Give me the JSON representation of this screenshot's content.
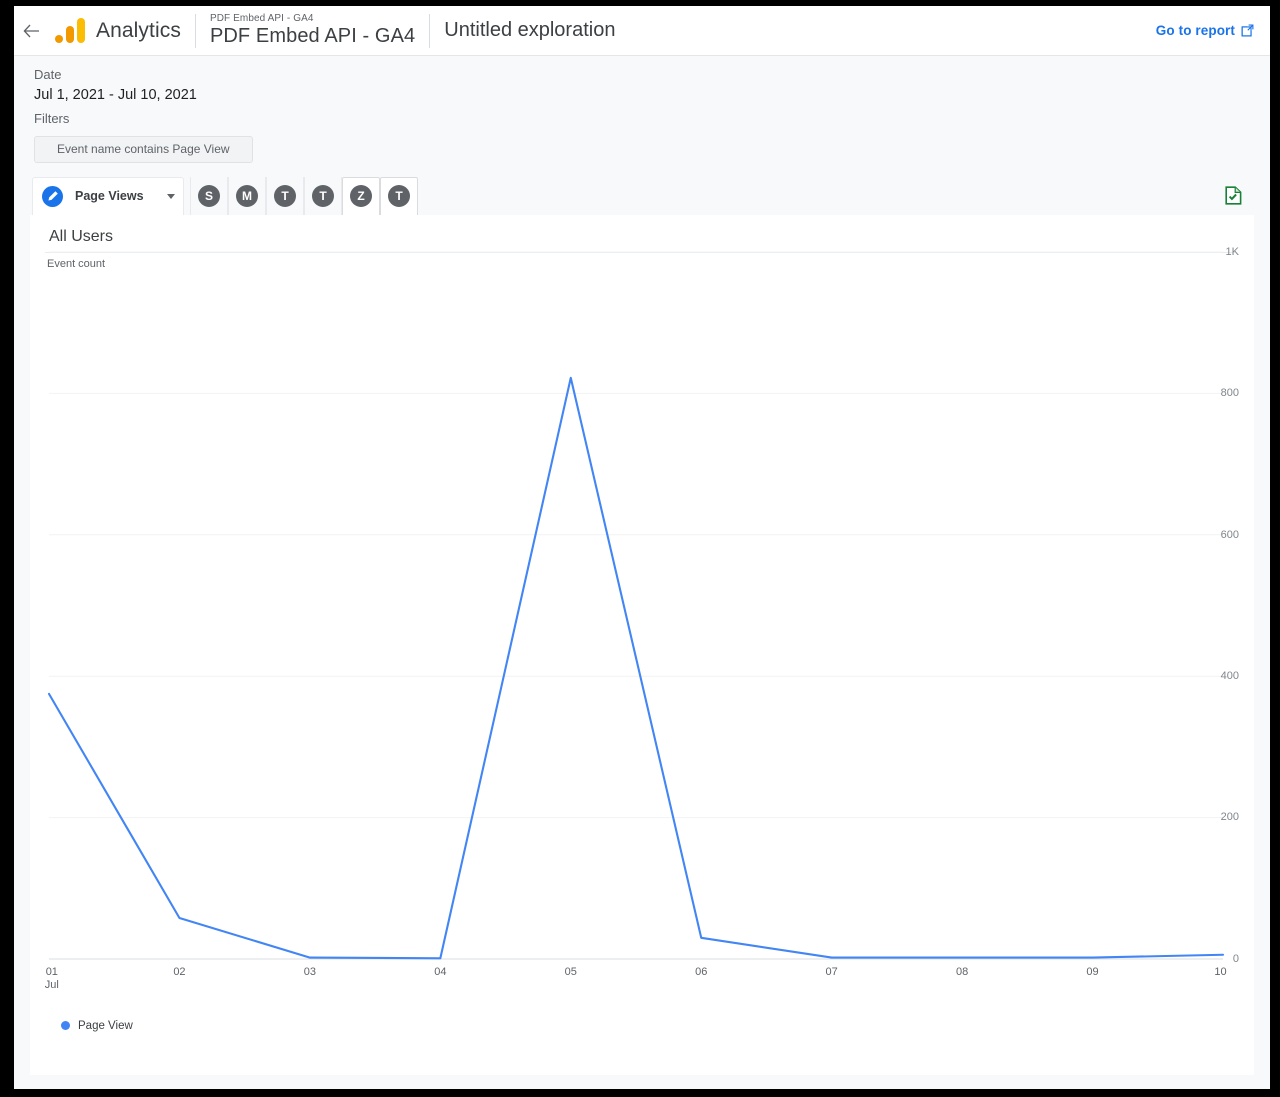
{
  "window": {
    "back_label": "←"
  },
  "header": {
    "logo_name": "google-analytics-logo",
    "brand": "Analytics",
    "property_sub": "PDF Embed API - GA4",
    "property_name": "PDF Embed API - GA4",
    "document_title": "Untitled exploration",
    "go_to_report": "Go to report",
    "accent_blue": "#1a73e8"
  },
  "meta": {
    "date_label": "Date",
    "date_value": "Jul 1, 2021 - Jul 10, 2021",
    "filters_label": "Filters",
    "filter_chip": "Event name contains Page View"
  },
  "toolbar": {
    "variable_label": "Page Views",
    "variable_icon": "pencil-icon",
    "caret_icon": "chevron-down-icon",
    "export_icon": "google-sheets-export-icon",
    "tabs": [
      {
        "letter": "S",
        "selected": false
      },
      {
        "letter": "M",
        "selected": false
      },
      {
        "letter": "T",
        "selected": false
      },
      {
        "letter": "T",
        "selected": false
      },
      {
        "letter": "Z",
        "selected": true
      },
      {
        "letter": "T",
        "selected": false
      }
    ]
  },
  "card": {
    "title": "All Users",
    "metric_label": "Event count"
  },
  "chart_data": {
    "type": "line",
    "title": "All Users",
    "ylabel": "Event count",
    "xlabel": "",
    "x": [
      "01",
      "02",
      "03",
      "04",
      "05",
      "06",
      "07",
      "08",
      "09",
      "10"
    ],
    "x_sub_first": "Jul",
    "series": [
      {
        "name": "Page View",
        "color": "#4285f4",
        "values": [
          375,
          58,
          2,
          1,
          822,
          30,
          2,
          2,
          2,
          6
        ]
      }
    ],
    "yticks": [
      0,
      200,
      400,
      600,
      800,
      1000
    ],
    "ytick_labels": [
      "0",
      "200",
      "400",
      "600",
      "800",
      "1K"
    ],
    "ylim": [
      0,
      1000
    ],
    "grid": true,
    "legend": [
      {
        "label": "Page View",
        "color": "#4285f4"
      }
    ],
    "legend_position": "bottom-left"
  }
}
